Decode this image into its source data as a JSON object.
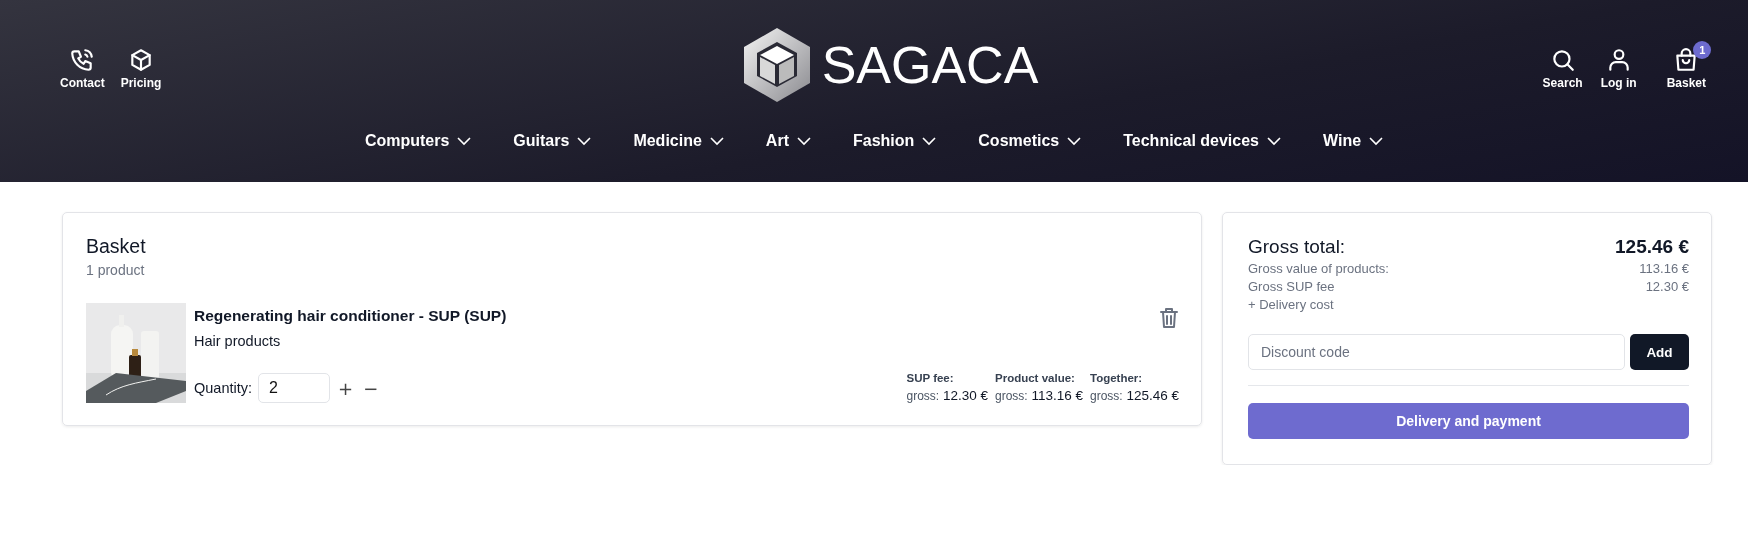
{
  "header": {
    "left_links": [
      {
        "label": "Contact"
      },
      {
        "label": "Pricing"
      }
    ],
    "logo": {
      "text": "SAGACA"
    },
    "right_links": [
      {
        "label": "Search"
      },
      {
        "label": "Log in"
      },
      {
        "label": "Basket",
        "badge": "1"
      }
    ],
    "nav": [
      "Computers",
      "Guitars",
      "Medicine",
      "Art",
      "Fashion",
      "Cosmetics",
      "Technical devices",
      "Wine"
    ]
  },
  "basket": {
    "title": "Basket",
    "count": "1 product",
    "items": [
      {
        "kind": "picture",
        "name": "Regenerating hair conditioner - SUP (SUP)",
        "category": "Hair products",
        "quantity_label": "Quantity:",
        "quantity": "2",
        "plus": "+",
        "minus": "−",
        "prices": [
          {
            "label": "SUP fee:",
            "prefix": "gross:",
            "amount": "12.30 €"
          },
          {
            "label": "Product value:",
            "prefix": "gross:",
            "amount": "113.16 €"
          },
          {
            "label": "Together:",
            "prefix": "gross:",
            "amount": "125.46 €"
          }
        ]
      }
    ]
  },
  "summary": {
    "total_label": "Gross total:",
    "total_value": "125.46 €",
    "rows": [
      {
        "label": "Gross value of products:",
        "value": "113.16 €"
      },
      {
        "label": "Gross SUP fee",
        "value": "12.30 €"
      }
    ],
    "note": "+ Delivery cost",
    "discount": {
      "placeholder": "Discount code",
      "button": "Add"
    },
    "checkout": "Delivery and payment"
  }
}
